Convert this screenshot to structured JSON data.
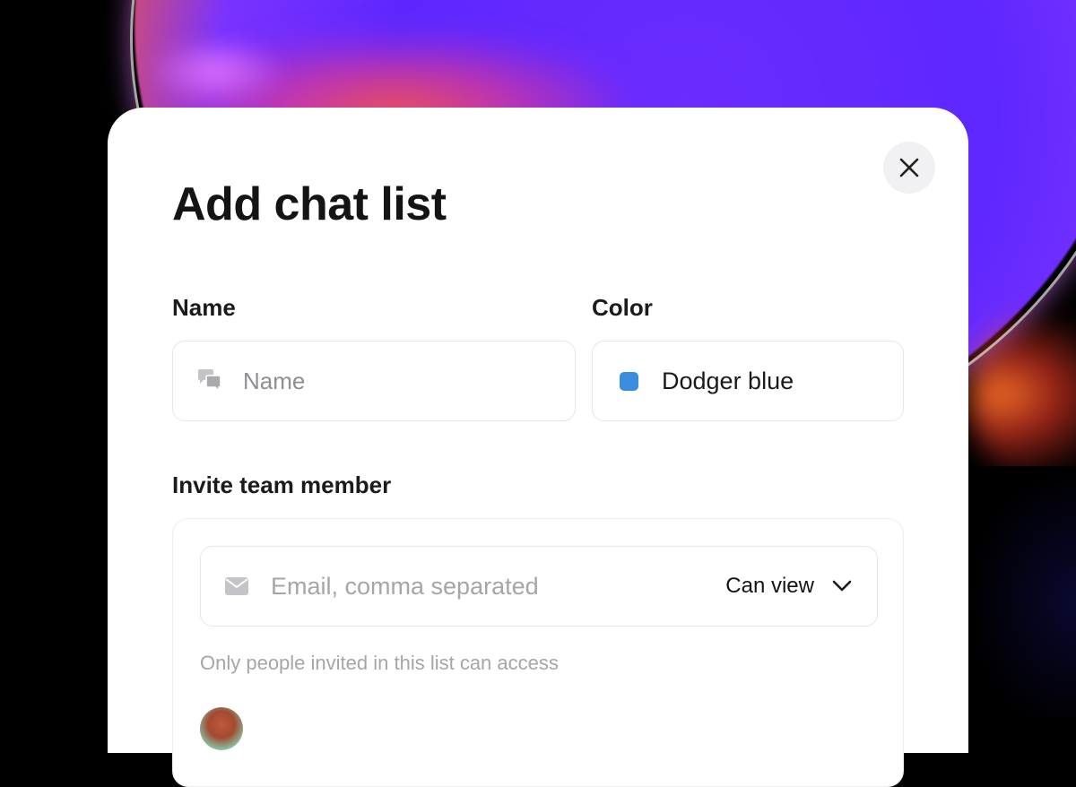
{
  "dialog": {
    "title": "Add chat list",
    "close_icon": "close-icon"
  },
  "name_field": {
    "label": "Name",
    "placeholder": "Name",
    "value": "",
    "icon": "chat-bubbles-icon"
  },
  "color_field": {
    "label": "Color",
    "value": "Dodger blue",
    "swatch_color": "#3A8DDE"
  },
  "invite": {
    "label": "Invite team member",
    "email_placeholder": "Email, comma separated",
    "email_value": "",
    "email_icon": "envelope-icon",
    "permission": "Can view",
    "permission_icon": "chevron-down-icon",
    "hint": "Only people invited in this list can access"
  },
  "colors": {
    "accent": "#3A8DDE",
    "background": "#000000",
    "dialog": "#FFFFFF"
  }
}
